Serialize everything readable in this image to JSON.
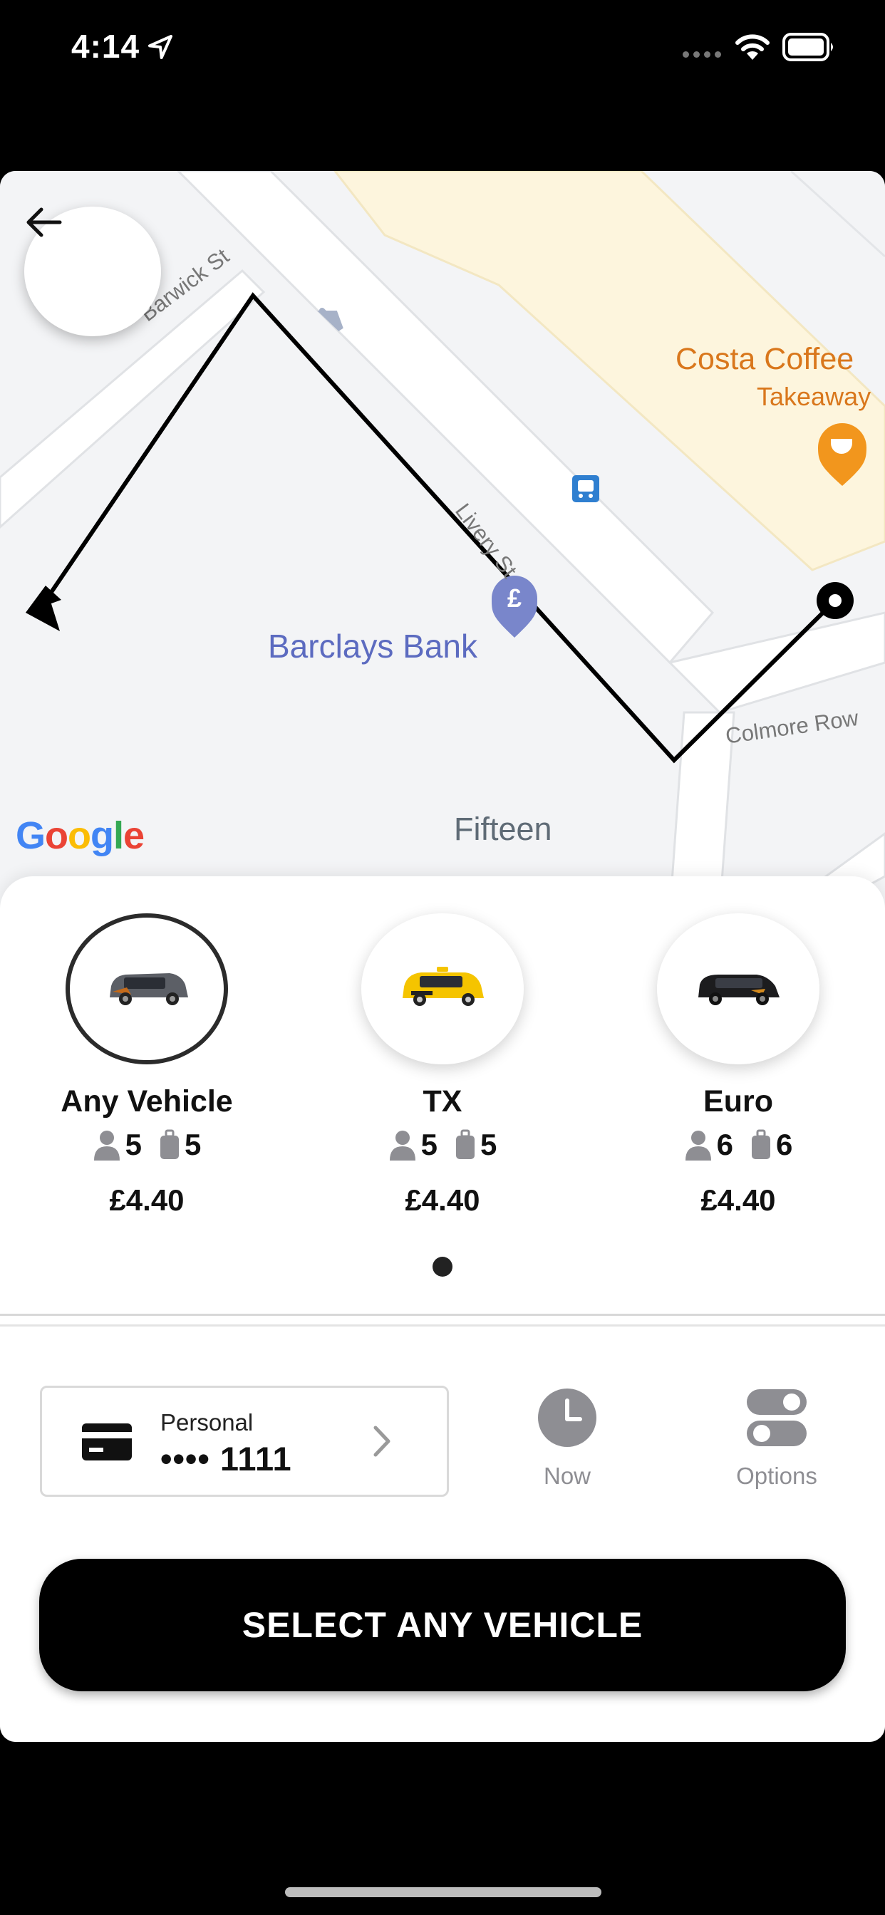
{
  "status_bar": {
    "time": "4:14"
  },
  "map": {
    "streets": [
      "Barwick St",
      "Livery St",
      "Colmore Row"
    ],
    "places": {
      "barclays": "Barclays Bank",
      "costa_name": "Costa Coffee",
      "costa_sub": "Takeaway",
      "fifteen": "Fifteen"
    },
    "attribution": "Google"
  },
  "vehicles": [
    {
      "name": "Any Vehicle",
      "passengers": "5",
      "luggage": "5",
      "price": "£4.40",
      "selected": true
    },
    {
      "name": "TX",
      "passengers": "5",
      "luggage": "5",
      "price": "£4.40",
      "selected": false
    },
    {
      "name": "Euro",
      "passengers": "6",
      "luggage": "6",
      "price": "£4.40",
      "selected": false
    }
  ],
  "payment": {
    "type": "Personal",
    "number": "•••• 1111"
  },
  "controls": {
    "now_label": "Now",
    "options_label": "Options"
  },
  "cta": {
    "label": "SELECT ANY VEHICLE"
  },
  "colors": {
    "accent": "#000000",
    "costa": "#d9771c",
    "barclays": "#5c6bc0"
  }
}
